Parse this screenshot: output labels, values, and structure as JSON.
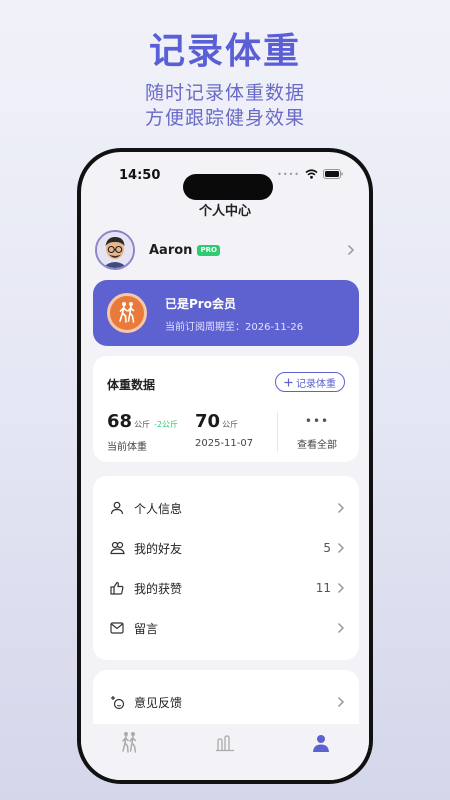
{
  "promo": {
    "title": "记录体重",
    "subtitle_line1": "随时记录体重数据",
    "subtitle_line2": "方便跟踪健身效果"
  },
  "status_bar": {
    "time": "14:50",
    "icons": [
      "signal-dots-icon",
      "wifi-icon",
      "battery-icon"
    ]
  },
  "page": {
    "title": "个人中心"
  },
  "profile": {
    "name": "Aaron",
    "badge": "PRO"
  },
  "vip": {
    "title": "已是Pro会员",
    "subtitle": "当前订阅周期至：2026-11-26"
  },
  "weight_card": {
    "title": "体重数据",
    "record_button": "记录体重",
    "current": {
      "value": "68",
      "unit": "公斤",
      "delta": "-2公斤",
      "label": "当前体重"
    },
    "previous": {
      "value": "70",
      "unit": "公斤",
      "date": "2025-11-07"
    },
    "view_all": {
      "more": "•••",
      "label": "查看全部"
    }
  },
  "menu": [
    {
      "label": "个人信息",
      "count": "",
      "icon": "person-icon"
    },
    {
      "label": "我的好友",
      "count": "5",
      "icon": "friends-icon"
    },
    {
      "label": "我的获赞",
      "count": "11",
      "icon": "thumbs-up-icon"
    },
    {
      "label": "留言",
      "count": "",
      "icon": "mail-icon"
    }
  ],
  "feedback": {
    "label": "意见反馈",
    "icon": "feedback-icon"
  },
  "tabbar": {
    "active_index": 2,
    "tabs": [
      "walking-icon",
      "chart-icon",
      "profile-icon"
    ]
  },
  "colors": {
    "accent": "#5e61d0",
    "badge_green": "#2ecc71",
    "vip_icon": "#e97a3c"
  }
}
